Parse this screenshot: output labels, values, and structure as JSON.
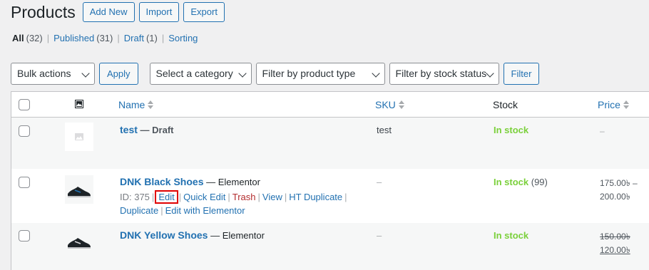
{
  "header": {
    "title": "Products",
    "actions": [
      "Add New",
      "Import",
      "Export"
    ]
  },
  "views": [
    {
      "label": "All",
      "count": "(32)",
      "current": true
    },
    {
      "label": "Published",
      "count": "(31)",
      "current": false
    },
    {
      "label": "Draft",
      "count": "(1)",
      "current": false
    },
    {
      "label": "Sorting",
      "count": "",
      "current": false
    }
  ],
  "filters": {
    "bulk_actions": "Bulk actions",
    "apply": "Apply",
    "category": "Select a category",
    "product_type": "Filter by product type",
    "stock_status": "Filter by stock status",
    "filter": "Filter"
  },
  "columns": {
    "name": "Name",
    "sku": "SKU",
    "stock": "Stock",
    "price": "Price"
  },
  "rows": [
    {
      "name": "test",
      "state": "— Draft",
      "sku": "test",
      "stock": "In stock",
      "stock_count": "",
      "price": "–"
    },
    {
      "name": "DNK Black Shoes",
      "state": "— Elementor",
      "id_label": "ID: 375",
      "actions": {
        "edit": "Edit",
        "quick_edit": "Quick Edit",
        "trash": "Trash",
        "view": "View",
        "ht_duplicate": "HT Duplicate",
        "duplicate": "Duplicate",
        "edit_elementor": "Edit with Elementor"
      },
      "sku": "–",
      "stock": "In stock",
      "stock_count": "(99)",
      "price_min": "175.00৳ –",
      "price_max": "200.00৳"
    },
    {
      "name": "DNK Yellow Shoes",
      "state": "— Elementor",
      "sku": "–",
      "stock": "In stock",
      "stock_count": "",
      "price_regular": "150.00৳",
      "price_sale": "120.00৳"
    }
  ]
}
